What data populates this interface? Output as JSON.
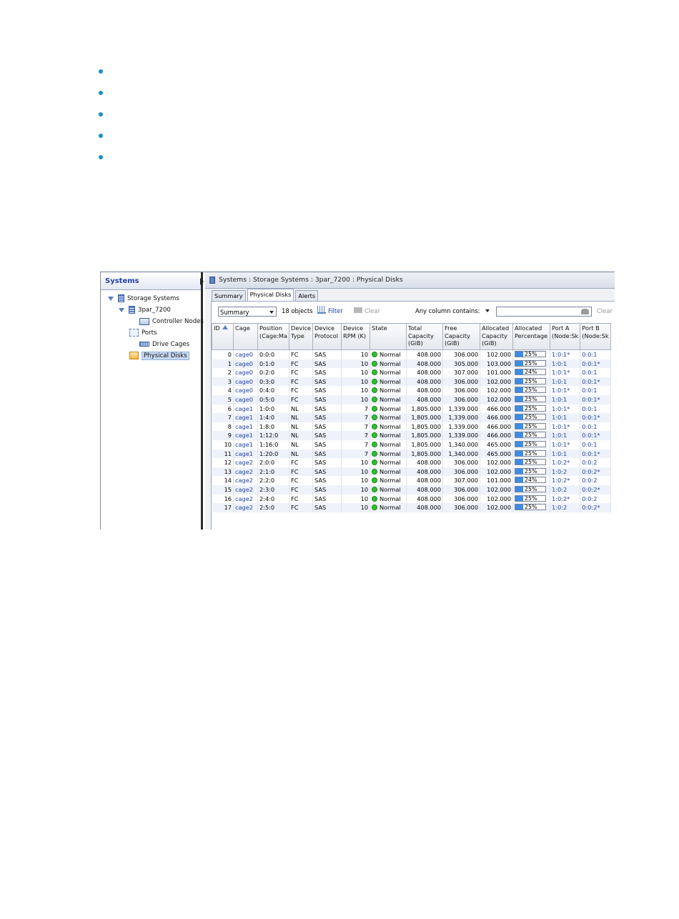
{
  "bullets": [
    "",
    "",
    "",
    "",
    ""
  ],
  "window": {
    "left_title": "Systems",
    "breadcrumb": "Systems : Storage Systems : 3par_7200 : Physical Disks"
  },
  "tree": [
    {
      "label": "Storage Systems",
      "icon": "storage-systems-icon",
      "twisty": "down",
      "indent": 0
    },
    {
      "label": "3par_7200",
      "icon": "storage-system-icon",
      "twisty": "down",
      "indent": 1
    },
    {
      "label": "Controller Nodes",
      "icon": "controller-nodes-icon",
      "twisty": "none",
      "indent": 2
    },
    {
      "label": "Ports",
      "icon": "ports-icon",
      "twisty": "right",
      "indent": 2
    },
    {
      "label": "Drive Cages",
      "icon": "drive-cages-icon",
      "twisty": "none",
      "indent": 2
    },
    {
      "label": "Physical Disks",
      "icon": "physical-disks-icon",
      "twisty": "right",
      "indent": 2,
      "selected": true
    }
  ],
  "tabs": [
    {
      "label": "Summary",
      "active": false
    },
    {
      "label": "Physical Disks",
      "active": true
    },
    {
      "label": "Alerts",
      "active": false
    }
  ],
  "toolbar": {
    "view_select": "Summary",
    "object_count": "18 objects",
    "filter_label": "Filter",
    "clear_label": "Clear",
    "any_column_label": "Any column contains:",
    "search_value": "",
    "search_clear_label": "Clear"
  },
  "table": {
    "columns": [
      {
        "label": "ID",
        "sort": "asc",
        "width": 30
      },
      {
        "label": "Cage",
        "width": 34
      },
      {
        "label": "Position\n(Cage:Ma",
        "width": 43
      },
      {
        "label": "Device\nType",
        "width": 33
      },
      {
        "label": "Device\nProtocol",
        "width": 40
      },
      {
        "label": "Device\nRPM (K)",
        "width": 40
      },
      {
        "label": "State",
        "width": 51
      },
      {
        "label": "Total\nCapacity\n(GiB)",
        "width": 51
      },
      {
        "label": "Free\nCapacity\n(GiB)",
        "width": 52
      },
      {
        "label": "Allocated\nCapacity\n(GiB)",
        "width": 46
      },
      {
        "label": "Allocated\nPercentage",
        "width": 52
      },
      {
        "label": "Port A\n(Node:Sk",
        "width": 42
      },
      {
        "label": "Port B\n(Node:Sk",
        "width": 42
      }
    ],
    "rows": [
      [
        "0",
        "cage0",
        "0:0:0",
        "FC",
        "SAS",
        "10",
        "Normal",
        "408.000",
        "306.000",
        "102.000",
        "25%",
        "1:0:1*",
        "0:0:1"
      ],
      [
        "1",
        "cage0",
        "0:1:0",
        "FC",
        "SAS",
        "10",
        "Normal",
        "408.000",
        "305.000",
        "103.000",
        "25%",
        "1:0:1",
        "0:0:1*"
      ],
      [
        "2",
        "cage0",
        "0:2:0",
        "FC",
        "SAS",
        "10",
        "Normal",
        "408.000",
        "307.000",
        "101.000",
        "24%",
        "1:0:1*",
        "0:0:1"
      ],
      [
        "3",
        "cage0",
        "0:3:0",
        "FC",
        "SAS",
        "10",
        "Normal",
        "408.000",
        "306.000",
        "102.000",
        "25%",
        "1:0:1",
        "0:0:1*"
      ],
      [
        "4",
        "cage0",
        "0:4:0",
        "FC",
        "SAS",
        "10",
        "Normal",
        "408.000",
        "306.000",
        "102.000",
        "25%",
        "1:0:1*",
        "0:0:1"
      ],
      [
        "5",
        "cage0",
        "0:5:0",
        "FC",
        "SAS",
        "10",
        "Normal",
        "408.000",
        "306.000",
        "102.000",
        "25%",
        "1:0:1",
        "0:0:1*"
      ],
      [
        "6",
        "cage1",
        "1:0:0",
        "NL",
        "SAS",
        "7",
        "Normal",
        "1,805.000",
        "1,339.000",
        "466.000",
        "25%",
        "1:0:1*",
        "0:0:1"
      ],
      [
        "7",
        "cage1",
        "1:4:0",
        "NL",
        "SAS",
        "7",
        "Normal",
        "1,805.000",
        "1,339.000",
        "466.000",
        "25%",
        "1:0:1",
        "0:0:1*"
      ],
      [
        "8",
        "cage1",
        "1:8:0",
        "NL",
        "SAS",
        "7",
        "Normal",
        "1,805.000",
        "1,339.000",
        "466.000",
        "25%",
        "1:0:1*",
        "0:0:1"
      ],
      [
        "9",
        "cage1",
        "1:12:0",
        "NL",
        "SAS",
        "7",
        "Normal",
        "1,805.000",
        "1,339.000",
        "466.000",
        "25%",
        "1:0:1",
        "0:0:1*"
      ],
      [
        "10",
        "cage1",
        "1:16:0",
        "NL",
        "SAS",
        "7",
        "Normal",
        "1,805.000",
        "1,340.000",
        "465.000",
        "25%",
        "1:0:1*",
        "0:0:1"
      ],
      [
        "11",
        "cage1",
        "1:20:0",
        "NL",
        "SAS",
        "7",
        "Normal",
        "1,805.000",
        "1,340.000",
        "465.000",
        "25%",
        "1:0:1",
        "0:0:1*"
      ],
      [
        "12",
        "cage2",
        "2:0:0",
        "FC",
        "SAS",
        "10",
        "Normal",
        "408.000",
        "306.000",
        "102.000",
        "25%",
        "1:0:2*",
        "0:0:2"
      ],
      [
        "13",
        "cage2",
        "2:1:0",
        "FC",
        "SAS",
        "10",
        "Normal",
        "408.000",
        "306.000",
        "102.000",
        "25%",
        "1:0:2",
        "0:0:2*"
      ],
      [
        "14",
        "cage2",
        "2:2:0",
        "FC",
        "SAS",
        "10",
        "Normal",
        "408.000",
        "307.000",
        "101.000",
        "24%",
        "1:0:2*",
        "0:0:2"
      ],
      [
        "15",
        "cage2",
        "2:3:0",
        "FC",
        "SAS",
        "10",
        "Normal",
        "408.000",
        "306.000",
        "102.000",
        "25%",
        "1:0:2",
        "0:0:2*"
      ],
      [
        "16",
        "cage2",
        "2:4:0",
        "FC",
        "SAS",
        "10",
        "Normal",
        "408.000",
        "306.000",
        "102.000",
        "25%",
        "1:0:2*",
        "0:0:2"
      ],
      [
        "17",
        "cage2",
        "2:5:0",
        "FC",
        "SAS",
        "10",
        "Normal",
        "408.000",
        "306.000",
        "102.000",
        "25%",
        "1:0:2",
        "0:0:2*"
      ]
    ]
  },
  "colors": {
    "accent": "#1f3fa6",
    "status_normal": "#2fbf2f",
    "bar_fill": "#3b8de8",
    "bullet": "#1a8fc8"
  }
}
